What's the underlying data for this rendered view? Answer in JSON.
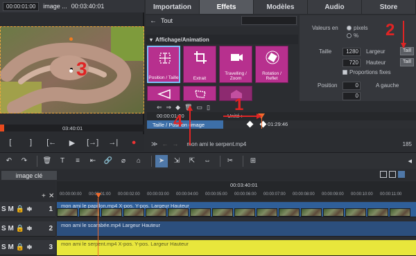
{
  "preview": {
    "timecode": "00:00:01:00",
    "title": "image ...",
    "duration": "00:03:40:01",
    "current_time": "03:40:01",
    "controls": [
      "[",
      "]",
      "[←",
      "▶",
      "[→]",
      "→|",
      "●"
    ]
  },
  "tabs": [
    {
      "label": "Importation",
      "active": false
    },
    {
      "label": "Effets",
      "active": true
    },
    {
      "label": "Modèles",
      "active": false
    },
    {
      "label": "Audio",
      "active": false
    },
    {
      "label": "Store",
      "active": false
    }
  ],
  "breadcrumb": {
    "back_icon": "arrow-left-icon",
    "label": "Tout"
  },
  "effects": {
    "category": "Affichage/Animation",
    "items": [
      {
        "label": "Position / Taille",
        "icon": "position-size-icon",
        "selected": true
      },
      {
        "label": "Extrait",
        "icon": "crop-icon",
        "selected": false
      },
      {
        "label": "Travelling / Zoom",
        "icon": "camera-icon",
        "selected": false
      },
      {
        "label": "Rotation / Reflet",
        "icon": "rotate-icon",
        "selected": false
      },
      {
        "label": "",
        "icon": "perspective-icon",
        "selected": false
      },
      {
        "label": "",
        "icon": "distort-icon",
        "selected": false
      },
      {
        "label": "",
        "icon": "shape-icon",
        "selected": false
      }
    ]
  },
  "properties": {
    "values_in_label": "Valeurs en",
    "unit_pixels": "pixels",
    "unit_percent": "%",
    "size_label": "Taille",
    "width_value": "1280",
    "width_label": "Largeur",
    "height_value": "720",
    "height_label": "Hauteur",
    "proportions_label": "Proportions fixes",
    "position_label": "Position",
    "position_value": "0",
    "left_label": "A gauche",
    "position_value_2": "0",
    "side_button_1": "Taill",
    "side_button_2": "Taill"
  },
  "keyframes": {
    "time_label": "00:00:01:00",
    "unit_label": "Unité :",
    "track_label": "Taille / Position (image",
    "keyframe_time": "01:29:46",
    "clip_name": "mon ami le serpent.mp4",
    "zoom_value": "185"
  },
  "timeline": {
    "tab_label": "image clé",
    "ruler_time": "00:03:40:01",
    "ruler_ticks": [
      "00:00:00:00",
      "00:00:01:00",
      "00:00:02:00",
      "00:00:03:00",
      "00:00:04:00",
      "00:00:05:00",
      "00:00:06:00",
      "00:00:07:00",
      "00:00:08:00",
      "00:00:09:00",
      "00:00:10:00",
      "00:00:11:00"
    ],
    "tracks": [
      {
        "number": "1",
        "clip": "mon ami le papillon.mp4  X-pos. Y-pos. Largeur  Hauteur",
        "color": "#2f5f99"
      },
      {
        "number": "2",
        "clip": "mon ami le scarabée.mp4  Largeur  Hauteur",
        "color": "#2c4f7d"
      },
      {
        "number": "3",
        "clip": "mon ami le serpent.mp4  X-pos. Y-pos. Largeur  Hauteur",
        "color": "#e8e63c"
      }
    ],
    "track_buttons": "S M"
  },
  "annotations": [
    "1",
    "2",
    "3",
    "4"
  ]
}
